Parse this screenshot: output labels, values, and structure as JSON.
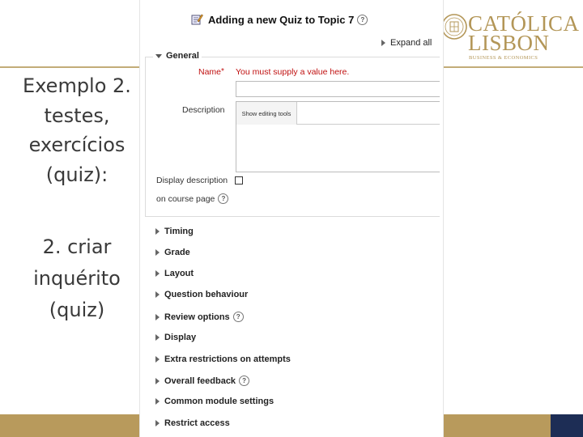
{
  "slide": {
    "title_lines": [
      "Exemplo 2.",
      "testes,",
      "exercícios",
      "(quiz):"
    ],
    "sub_lines": [
      "2. criar",
      "inquérito",
      "(quiz)"
    ]
  },
  "logo": {
    "line1": "CATÓLICA",
    "line2": "LISBON",
    "tag": "BUSINESS & ECONOMICS"
  },
  "moodle": {
    "heading": "Adding a new Quiz to Topic 7",
    "expand_all": "Expand all",
    "general_legend": "General",
    "name_label": "Name",
    "required_mark": "*",
    "name_error": "You must supply a value here.",
    "name_value": "",
    "description_label": "Description",
    "show_editing_tools": "Show editing tools",
    "display_desc_line1": "Display description",
    "display_desc_line2": "on course page",
    "sections": [
      "Timing",
      "Grade",
      "Layout",
      "Question behaviour",
      "Review options",
      "Display",
      "Extra restrictions on attempts",
      "Overall feedback",
      "Common module settings",
      "Restrict access"
    ],
    "help_glyph": "?"
  },
  "colors": {
    "gold": "#b89a5c",
    "navy": "#1d2d55",
    "error": "#c01010"
  }
}
